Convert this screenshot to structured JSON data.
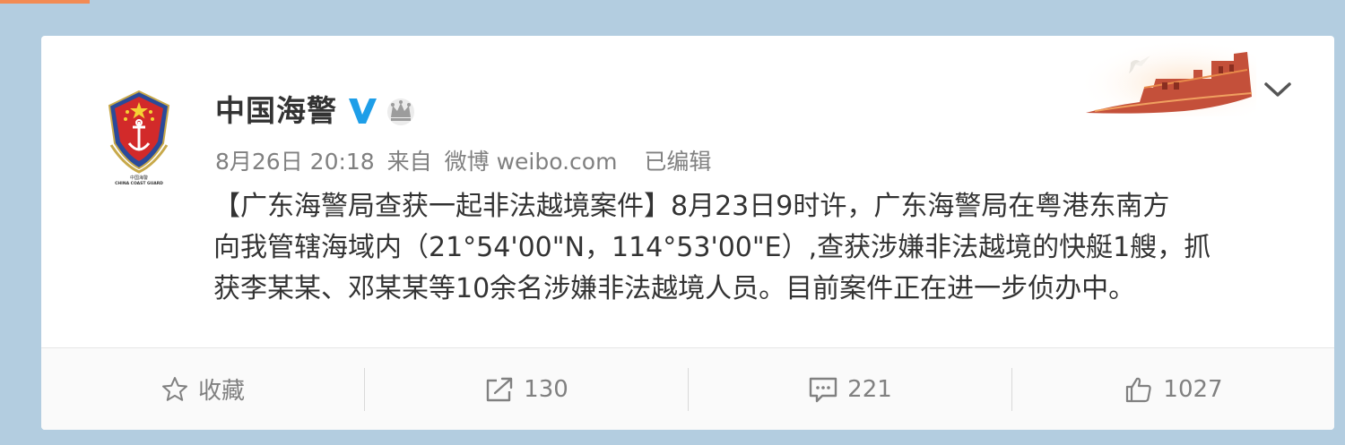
{
  "post": {
    "author": "中国海警",
    "avatar": {
      "text_cn": "中国海警",
      "text_en": "CHINA COAST GUARD"
    },
    "date": "8月26日 20:18",
    "from_label": "来自",
    "source": "微博 weibo.com",
    "edited_label": "已编辑",
    "content_lines": [
      "【广东海警局查获一起非法越境案件】8月23日9时许，广东海警局在粤港东南方",
      "向我管辖海域内（21°54'00\"N，114°53'00\"E）,查获涉嫌非法越境的快艇1艘，抓",
      "获李某某、邓某某等10余名涉嫌非法越境人员。目前案件正在进一步侦办中。"
    ]
  },
  "actions": {
    "favorite_label": "收藏",
    "repost_count": "130",
    "comment_count": "221",
    "like_count": "1027"
  },
  "colors": {
    "page_bg": "#b3cde0",
    "card_bg": "#ffffff",
    "verified": "#1e9ee8",
    "muted_text": "#808080"
  }
}
